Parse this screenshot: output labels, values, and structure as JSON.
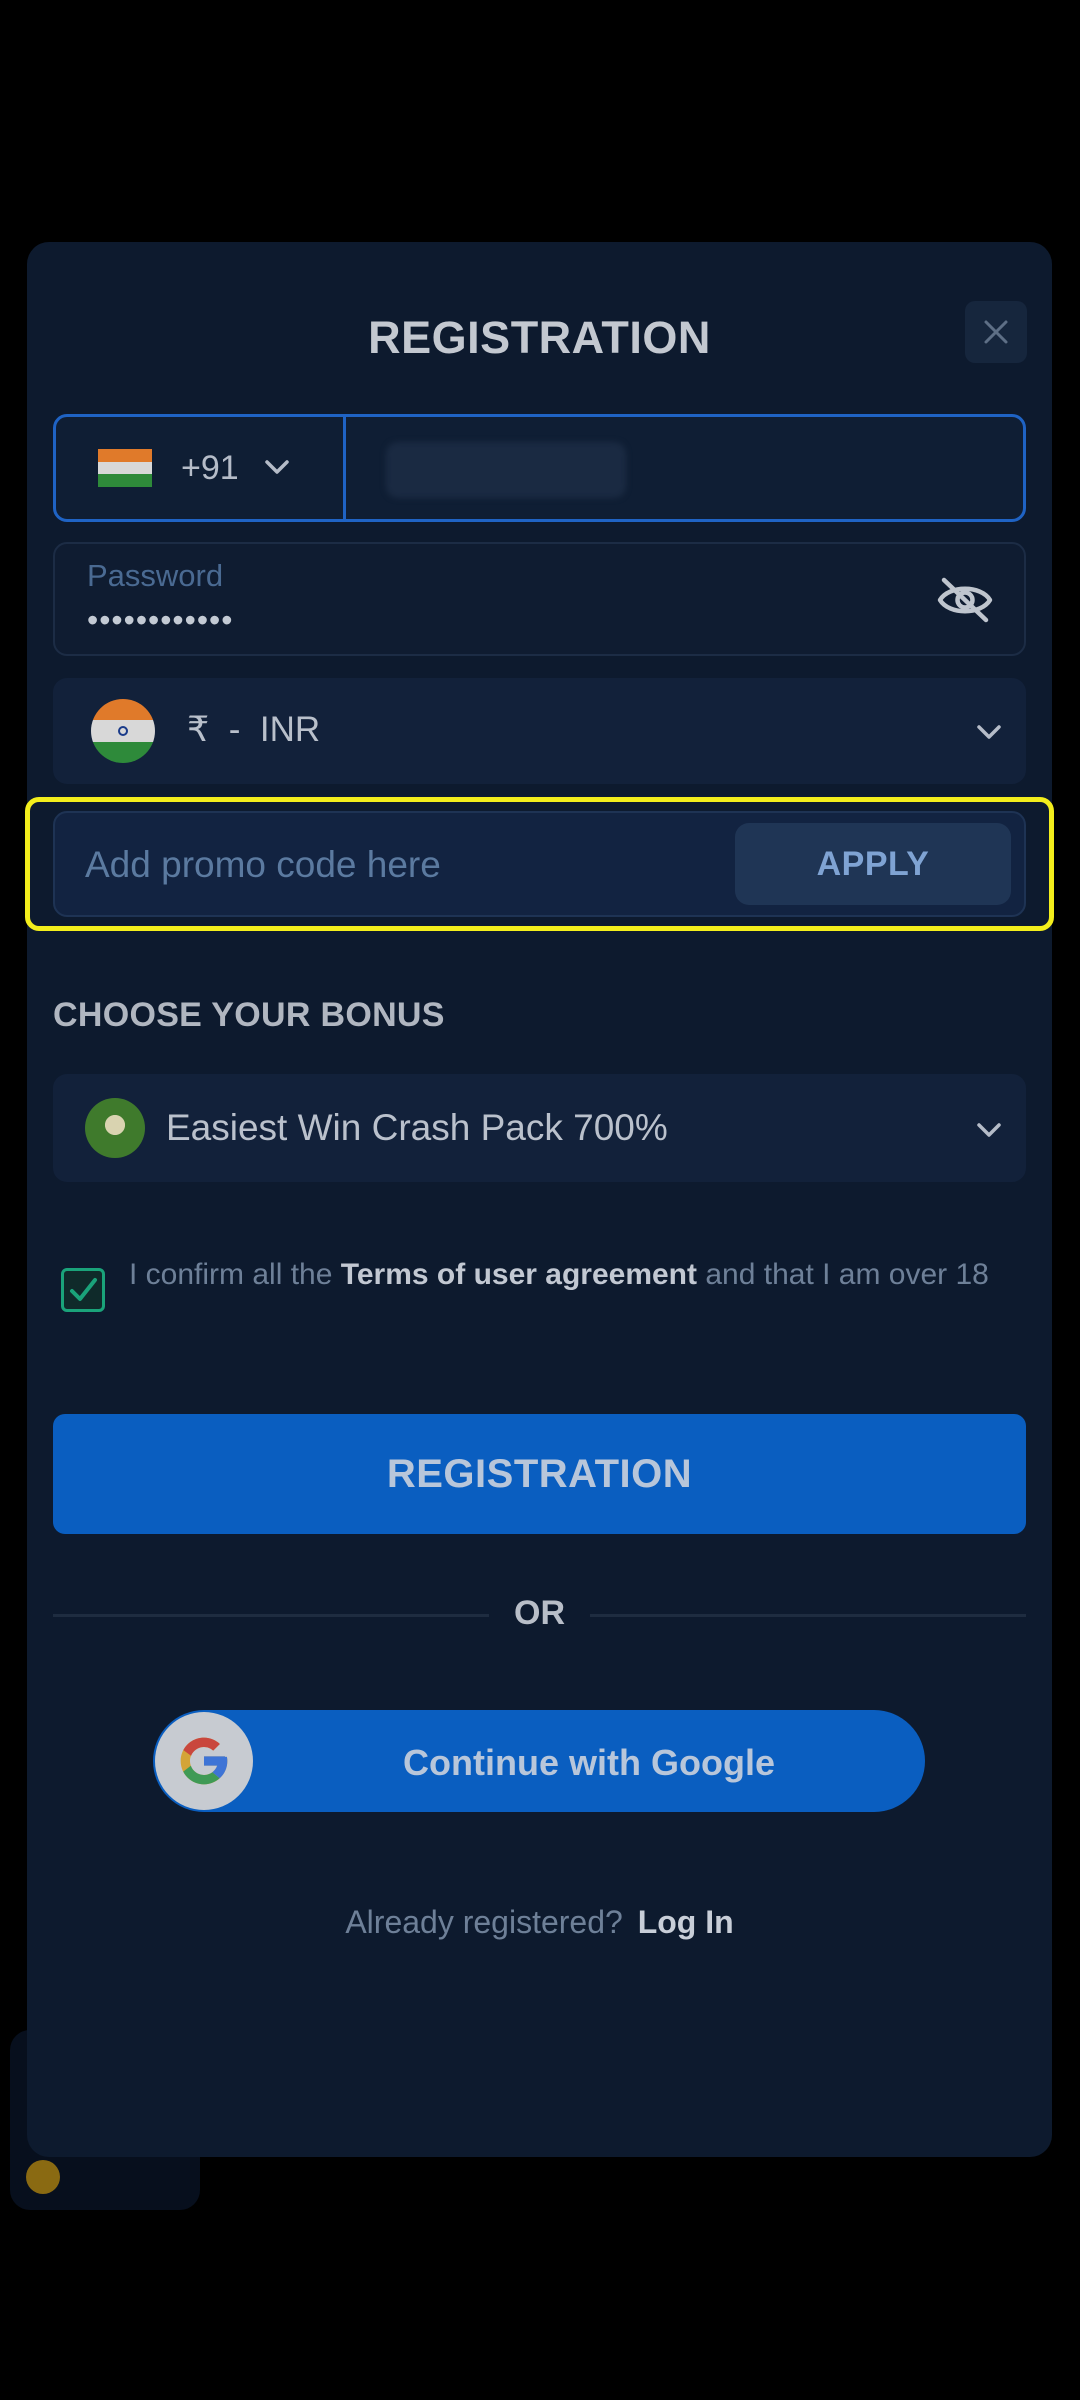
{
  "modal": {
    "title": "REGISTRATION",
    "close_icon": "close-icon"
  },
  "phone": {
    "country_flag": "india-flag-icon",
    "dial_code": "+91",
    "number_value": ""
  },
  "password": {
    "label": "Password",
    "value": "••••••••••••",
    "visibility_icon": "eye-slash-icon"
  },
  "currency": {
    "flag": "india-flag-icon",
    "symbol": "₹",
    "separator": "-",
    "code": "INR"
  },
  "promo": {
    "placeholder": "Add promo code here",
    "apply_label": "APPLY"
  },
  "bonus": {
    "heading": "CHOOSE YOUR BONUS",
    "selected": "Easiest Win Crash Pack 700%"
  },
  "terms": {
    "checked": true,
    "prefix": "I confirm all the",
    "link": "Terms of user agreement",
    "suffix": "and that I am over 18"
  },
  "register_label": "REGISTRATION",
  "divider_label": "OR",
  "google_label": "Continue with Google",
  "login": {
    "prompt": "Already registered?",
    "link": "Log In"
  },
  "colors": {
    "backdrop": "#000000",
    "modal_bg": "#0d1a2e",
    "accent_blue": "#0a5ec0",
    "field_border_focus": "#1f63c4",
    "highlight_yellow": "#f3ee1c",
    "checkbox_green": "#1aa37a"
  }
}
